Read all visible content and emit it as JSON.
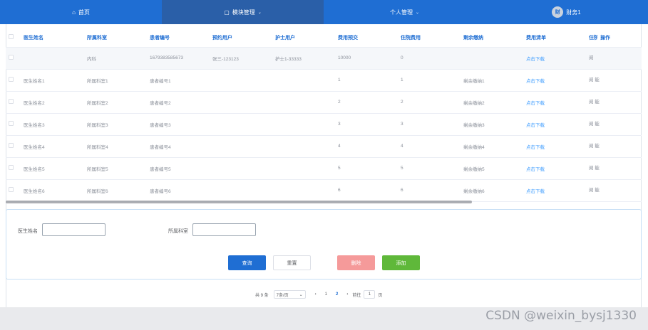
{
  "nav": [
    {
      "label": "首页",
      "icon": "home-icon"
    },
    {
      "label": "模块管理",
      "icon": "module-icon"
    },
    {
      "label": "个人管理"
    },
    {
      "label": "财务1",
      "avatar": "财"
    }
  ],
  "table": {
    "columns": [
      "医生姓名",
      "所属科室",
      "患者编号",
      "预约用户",
      "护士用户",
      "费用预交",
      "住院费用",
      "剩余缴纳",
      "费用清单",
      "住院",
      "操作"
    ],
    "rows": [
      {
        "doctor": "",
        "dept": "内科",
        "patient": "1679383585673",
        "user": "张三-123123",
        "nurse": "护士1-33333",
        "prepay": "10000",
        "fee": "0",
        "remain": "",
        "bill": "点击下载",
        "status": "阅",
        "action": "详情"
      },
      {
        "doctor": "医生姓名1",
        "dept": "所属科室1",
        "patient": "患者编号1",
        "user": "",
        "nurse": "",
        "prepay": "1",
        "fee": "1",
        "remain": "剩余缴纳1",
        "bill": "点击下载",
        "status": "阅 能",
        "action": "详情"
      },
      {
        "doctor": "医生姓名2",
        "dept": "所属科室2",
        "patient": "患者编号2",
        "user": "",
        "nurse": "",
        "prepay": "2",
        "fee": "2",
        "remain": "剩余缴纳2",
        "bill": "点击下载",
        "status": "阅 能",
        "action": "详情"
      },
      {
        "doctor": "医生姓名3",
        "dept": "所属科室3",
        "patient": "患者编号3",
        "user": "",
        "nurse": "",
        "prepay": "3",
        "fee": "3",
        "remain": "剩余缴纳3",
        "bill": "点击下载",
        "status": "阅 能",
        "action": "详情"
      },
      {
        "doctor": "医生姓名4",
        "dept": "所属科室4",
        "patient": "患者编号4",
        "user": "",
        "nurse": "",
        "prepay": "4",
        "fee": "4",
        "remain": "剩余缴纳4",
        "bill": "点击下载",
        "status": "阅 能",
        "action": "详情"
      },
      {
        "doctor": "医生姓名5",
        "dept": "所属科室5",
        "patient": "患者编号5",
        "user": "",
        "nurse": "",
        "prepay": "5",
        "fee": "5",
        "remain": "剩余缴纳5",
        "bill": "点击下载",
        "status": "阅 能",
        "action": "详情"
      },
      {
        "doctor": "医生姓名6",
        "dept": "所属科室6",
        "patient": "患者编号6",
        "user": "",
        "nurse": "",
        "prepay": "6",
        "fee": "6",
        "remain": "剩余缴纳6",
        "bill": "点击下载",
        "status": "阅 能",
        "action": "详情"
      }
    ]
  },
  "filter": {
    "doctor_label": "医生姓名",
    "dept_label": "所属科室",
    "doctor_value": "",
    "dept_value": "",
    "query": "查询",
    "reset": "重置",
    "delete": "删除",
    "add": "添加"
  },
  "pagination": {
    "total": "共 9 条",
    "page_size": "7条/页",
    "prev": "‹",
    "pages": [
      "1",
      "2"
    ],
    "current": "2",
    "next": "›",
    "goto_label": "前往",
    "goto_value": "1",
    "page_suffix": "页"
  },
  "watermark": "CSDN @weixin_bysj1330",
  "colors": {
    "primary": "#1f6ed3",
    "query": "#1f6ed3",
    "delete": "#f59a9a",
    "add": "#5fb83a",
    "link": "#409eff"
  }
}
